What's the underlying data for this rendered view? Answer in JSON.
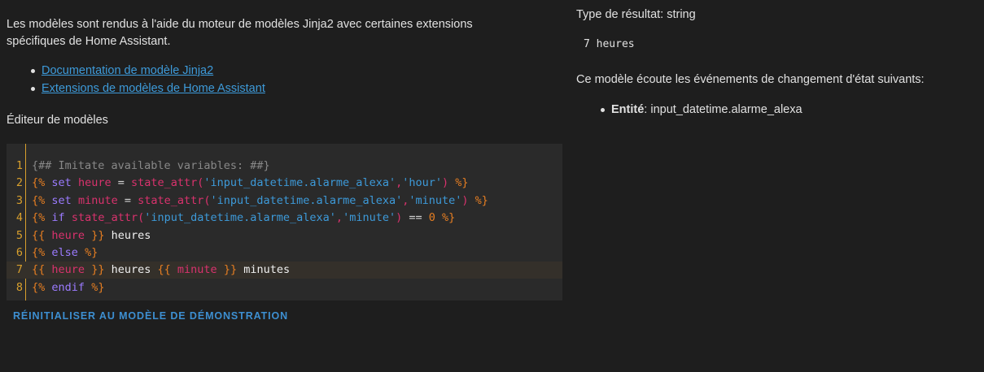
{
  "intro": {
    "text": "Les modèles sont rendus à l'aide du moteur de modèles Jinja2 avec certaines extensions spécifiques de Home Assistant."
  },
  "doc_links": [
    {
      "label": "Documentation de modèle Jinja2"
    },
    {
      "label": "Extensions de modèles de Home Assistant"
    }
  ],
  "editor": {
    "heading": "Éditeur de modèles",
    "active_line": 7,
    "line_numbers": [
      "1",
      "2",
      "3",
      "4",
      "5",
      "6",
      "7",
      "8"
    ],
    "lines": [
      [
        {
          "t": "cmt",
          "v": "{## Imitate available variables: ##}"
        }
      ],
      [
        {
          "t": "delim",
          "v": "{%"
        },
        {
          "t": "op",
          "v": " "
        },
        {
          "t": "kw",
          "v": "set"
        },
        {
          "t": "op",
          "v": " "
        },
        {
          "t": "var",
          "v": "heure"
        },
        {
          "t": "op",
          "v": " = "
        },
        {
          "t": "fn",
          "v": "state_attr("
        },
        {
          "t": "str",
          "v": "'input_datetime.alarme_alexa'"
        },
        {
          "t": "fn",
          "v": ","
        },
        {
          "t": "str",
          "v": "'hour'"
        },
        {
          "t": "fn",
          "v": ")"
        },
        {
          "t": "op",
          "v": " "
        },
        {
          "t": "delim",
          "v": "%}"
        }
      ],
      [
        {
          "t": "delim",
          "v": "{%"
        },
        {
          "t": "op",
          "v": " "
        },
        {
          "t": "kw",
          "v": "set"
        },
        {
          "t": "op",
          "v": " "
        },
        {
          "t": "var",
          "v": "minute"
        },
        {
          "t": "op",
          "v": " = "
        },
        {
          "t": "fn",
          "v": "state_attr("
        },
        {
          "t": "str",
          "v": "'input_datetime.alarme_alexa'"
        },
        {
          "t": "fn",
          "v": ","
        },
        {
          "t": "str",
          "v": "'minute'"
        },
        {
          "t": "fn",
          "v": ")"
        },
        {
          "t": "op",
          "v": " "
        },
        {
          "t": "delim",
          "v": "%}"
        }
      ],
      [
        {
          "t": "delim",
          "v": "{%"
        },
        {
          "t": "op",
          "v": " "
        },
        {
          "t": "kw",
          "v": "if"
        },
        {
          "t": "op",
          "v": " "
        },
        {
          "t": "fn",
          "v": "state_attr("
        },
        {
          "t": "str",
          "v": "'input_datetime.alarme_alexa'"
        },
        {
          "t": "fn",
          "v": ","
        },
        {
          "t": "str",
          "v": "'minute'"
        },
        {
          "t": "fn",
          "v": ")"
        },
        {
          "t": "op",
          "v": " == "
        },
        {
          "t": "num",
          "v": "0"
        },
        {
          "t": "op",
          "v": " "
        },
        {
          "t": "delim",
          "v": "%}"
        }
      ],
      [
        {
          "t": "delim",
          "v": "{{"
        },
        {
          "t": "op",
          "v": " "
        },
        {
          "t": "var",
          "v": "heure"
        },
        {
          "t": "op",
          "v": " "
        },
        {
          "t": "delim",
          "v": "}}"
        },
        {
          "t": "txt",
          "v": " heures"
        }
      ],
      [
        {
          "t": "delim",
          "v": "{%"
        },
        {
          "t": "op",
          "v": " "
        },
        {
          "t": "kw",
          "v": "else"
        },
        {
          "t": "op",
          "v": " "
        },
        {
          "t": "delim",
          "v": "%}"
        }
      ],
      [
        {
          "t": "delim",
          "v": "{{"
        },
        {
          "t": "op",
          "v": " "
        },
        {
          "t": "var",
          "v": "heure"
        },
        {
          "t": "op",
          "v": " "
        },
        {
          "t": "delim",
          "v": "}}"
        },
        {
          "t": "txt",
          "v": " heures "
        },
        {
          "t": "delim",
          "v": "{{"
        },
        {
          "t": "op",
          "v": " "
        },
        {
          "t": "var",
          "v": "minute"
        },
        {
          "t": "op",
          "v": " "
        },
        {
          "t": "delim",
          "v": "}}"
        },
        {
          "t": "txt",
          "v": " minutes"
        }
      ],
      [
        {
          "t": "delim",
          "v": "{%"
        },
        {
          "t": "op",
          "v": " "
        },
        {
          "t": "kw",
          "v": "endif"
        },
        {
          "t": "op",
          "v": " "
        },
        {
          "t": "delim",
          "v": "%}"
        }
      ]
    ]
  },
  "reset_button": {
    "label": "RÉINITIALISER AU MODÈLE DE DÉMONSTRATION"
  },
  "result": {
    "type_text": "Type de résultat: string",
    "value": "7 heures",
    "listen_text": "Ce modèle écoute les événements de changement d'état suivants:",
    "entities": [
      {
        "label": "Entité",
        "value": "input_datetime.alarme_alexa"
      }
    ]
  },
  "colors": {
    "background": "#1e1e1e",
    "editor_background": "#2a2a2a",
    "active_line": "#34302a",
    "line_number": "#d9a02d",
    "link": "#3d9ad9",
    "button": "#3d8fd1"
  }
}
